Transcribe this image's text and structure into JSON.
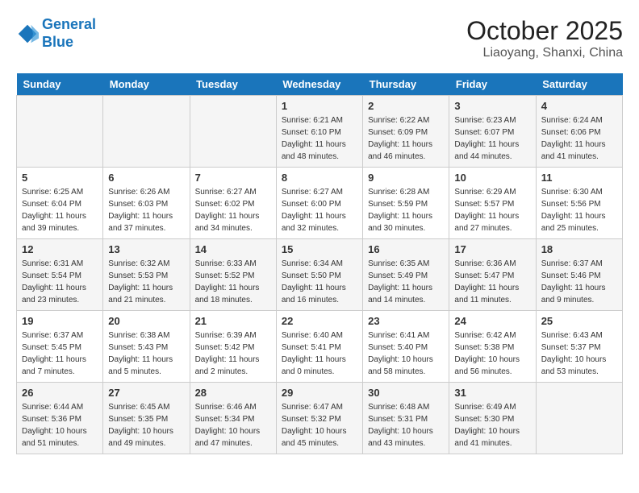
{
  "header": {
    "logo_line1": "General",
    "logo_line2": "Blue",
    "month": "October 2025",
    "location": "Liaoyang, Shanxi, China"
  },
  "weekdays": [
    "Sunday",
    "Monday",
    "Tuesday",
    "Wednesday",
    "Thursday",
    "Friday",
    "Saturday"
  ],
  "weeks": [
    [
      {
        "day": "",
        "info": ""
      },
      {
        "day": "",
        "info": ""
      },
      {
        "day": "",
        "info": ""
      },
      {
        "day": "1",
        "info": "Sunrise: 6:21 AM\nSunset: 6:10 PM\nDaylight: 11 hours\nand 48 minutes."
      },
      {
        "day": "2",
        "info": "Sunrise: 6:22 AM\nSunset: 6:09 PM\nDaylight: 11 hours\nand 46 minutes."
      },
      {
        "day": "3",
        "info": "Sunrise: 6:23 AM\nSunset: 6:07 PM\nDaylight: 11 hours\nand 44 minutes."
      },
      {
        "day": "4",
        "info": "Sunrise: 6:24 AM\nSunset: 6:06 PM\nDaylight: 11 hours\nand 41 minutes."
      }
    ],
    [
      {
        "day": "5",
        "info": "Sunrise: 6:25 AM\nSunset: 6:04 PM\nDaylight: 11 hours\nand 39 minutes."
      },
      {
        "day": "6",
        "info": "Sunrise: 6:26 AM\nSunset: 6:03 PM\nDaylight: 11 hours\nand 37 minutes."
      },
      {
        "day": "7",
        "info": "Sunrise: 6:27 AM\nSunset: 6:02 PM\nDaylight: 11 hours\nand 34 minutes."
      },
      {
        "day": "8",
        "info": "Sunrise: 6:27 AM\nSunset: 6:00 PM\nDaylight: 11 hours\nand 32 minutes."
      },
      {
        "day": "9",
        "info": "Sunrise: 6:28 AM\nSunset: 5:59 PM\nDaylight: 11 hours\nand 30 minutes."
      },
      {
        "day": "10",
        "info": "Sunrise: 6:29 AM\nSunset: 5:57 PM\nDaylight: 11 hours\nand 27 minutes."
      },
      {
        "day": "11",
        "info": "Sunrise: 6:30 AM\nSunset: 5:56 PM\nDaylight: 11 hours\nand 25 minutes."
      }
    ],
    [
      {
        "day": "12",
        "info": "Sunrise: 6:31 AM\nSunset: 5:54 PM\nDaylight: 11 hours\nand 23 minutes."
      },
      {
        "day": "13",
        "info": "Sunrise: 6:32 AM\nSunset: 5:53 PM\nDaylight: 11 hours\nand 21 minutes."
      },
      {
        "day": "14",
        "info": "Sunrise: 6:33 AM\nSunset: 5:52 PM\nDaylight: 11 hours\nand 18 minutes."
      },
      {
        "day": "15",
        "info": "Sunrise: 6:34 AM\nSunset: 5:50 PM\nDaylight: 11 hours\nand 16 minutes."
      },
      {
        "day": "16",
        "info": "Sunrise: 6:35 AM\nSunset: 5:49 PM\nDaylight: 11 hours\nand 14 minutes."
      },
      {
        "day": "17",
        "info": "Sunrise: 6:36 AM\nSunset: 5:47 PM\nDaylight: 11 hours\nand 11 minutes."
      },
      {
        "day": "18",
        "info": "Sunrise: 6:37 AM\nSunset: 5:46 PM\nDaylight: 11 hours\nand 9 minutes."
      }
    ],
    [
      {
        "day": "19",
        "info": "Sunrise: 6:37 AM\nSunset: 5:45 PM\nDaylight: 11 hours\nand 7 minutes."
      },
      {
        "day": "20",
        "info": "Sunrise: 6:38 AM\nSunset: 5:43 PM\nDaylight: 11 hours\nand 5 minutes."
      },
      {
        "day": "21",
        "info": "Sunrise: 6:39 AM\nSunset: 5:42 PM\nDaylight: 11 hours\nand 2 minutes."
      },
      {
        "day": "22",
        "info": "Sunrise: 6:40 AM\nSunset: 5:41 PM\nDaylight: 11 hours\nand 0 minutes."
      },
      {
        "day": "23",
        "info": "Sunrise: 6:41 AM\nSunset: 5:40 PM\nDaylight: 10 hours\nand 58 minutes."
      },
      {
        "day": "24",
        "info": "Sunrise: 6:42 AM\nSunset: 5:38 PM\nDaylight: 10 hours\nand 56 minutes."
      },
      {
        "day": "25",
        "info": "Sunrise: 6:43 AM\nSunset: 5:37 PM\nDaylight: 10 hours\nand 53 minutes."
      }
    ],
    [
      {
        "day": "26",
        "info": "Sunrise: 6:44 AM\nSunset: 5:36 PM\nDaylight: 10 hours\nand 51 minutes."
      },
      {
        "day": "27",
        "info": "Sunrise: 6:45 AM\nSunset: 5:35 PM\nDaylight: 10 hours\nand 49 minutes."
      },
      {
        "day": "28",
        "info": "Sunrise: 6:46 AM\nSunset: 5:34 PM\nDaylight: 10 hours\nand 47 minutes."
      },
      {
        "day": "29",
        "info": "Sunrise: 6:47 AM\nSunset: 5:32 PM\nDaylight: 10 hours\nand 45 minutes."
      },
      {
        "day": "30",
        "info": "Sunrise: 6:48 AM\nSunset: 5:31 PM\nDaylight: 10 hours\nand 43 minutes."
      },
      {
        "day": "31",
        "info": "Sunrise: 6:49 AM\nSunset: 5:30 PM\nDaylight: 10 hours\nand 41 minutes."
      },
      {
        "day": "",
        "info": ""
      }
    ]
  ]
}
